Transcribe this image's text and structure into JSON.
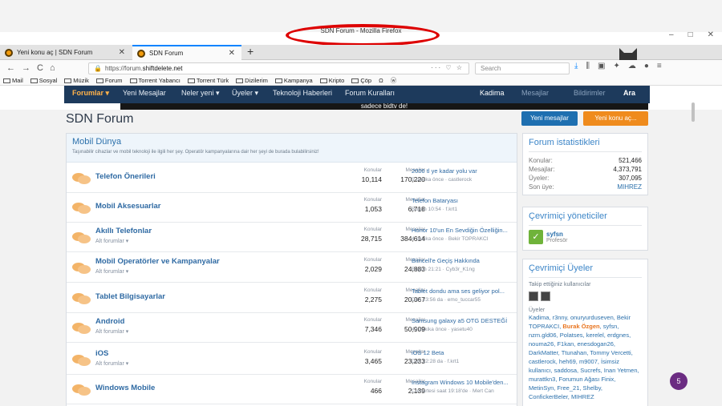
{
  "window": {
    "title": "SDN Forum - Mozilla Firefox",
    "controls": [
      "–",
      "□",
      "✕"
    ]
  },
  "tabs": [
    {
      "label": "Yeni konu aç | SDN Forum",
      "close": "✕"
    },
    {
      "label": "SDN Forum",
      "close": "✕"
    }
  ],
  "new_tab": "+",
  "nav": {
    "back": "←",
    "forward": "→",
    "reload": "C",
    "home": "⌂"
  },
  "url": {
    "prefix": "https://forum.",
    "host": "shiftdelete.net",
    "actions": "··· ♡ ☆"
  },
  "search": {
    "placeholder": "Search"
  },
  "toolbar_icons": [
    "⤓",
    "⫼",
    "▣",
    "✦",
    "☁",
    "●",
    "≡"
  ],
  "bookmarks": [
    "Mail",
    "Sosyal",
    "Müzik",
    "Forum",
    "Torrent Yabancı",
    "Torrent Türk",
    "Dizilerim",
    "Kampanya",
    "Kripto",
    "Çöp",
    "Ω",
    "ⓦ"
  ],
  "site_nav": {
    "items": [
      "Forumlar ▾",
      "Yeni Mesajlar",
      "Neler yeni ▾",
      "Üyeler ▾",
      "Teknoloji Haberleri",
      "Forum Kuralları"
    ],
    "right": [
      "Kadima",
      "Mesajlar",
      "Bildirimler",
      "Ara"
    ]
  },
  "strip_text": "sadece bidtv de!",
  "page": {
    "title": "SDN Forum",
    "new_messages_btn": "Yeni mesajlar",
    "new_topic_btn": "Yeni konu aç..."
  },
  "category": {
    "title": "Mobil Dünya",
    "desc": "Taşınabilir cihazlar ve mobil teknoloji ile ilgili her şey. Operatör kampanyalarına dair her şeyi de burada bulabilirsiniz!"
  },
  "forums": [
    {
      "name": "Telefon Önerileri",
      "sub": "",
      "konular": "10,114",
      "mesajlar": "170,220",
      "last_title": "2000 tl ye kadar yolu var",
      "last_meta": "5 dakika önce · castlerock"
    },
    {
      "name": "Mobil Aksesuarlar",
      "sub": "",
      "konular": "1,053",
      "mesajlar": "6,718",
      "last_title": "Telefon Bataryası",
      "last_meta": "Bugün 10:54 · f.krt1"
    },
    {
      "name": "Akıllı Telefonlar",
      "sub": "Alt forumlar ▾",
      "konular": "28,715",
      "mesajlar": "384,614",
      "last_title": "Honor 10'un En Sevdiğin Özelliğin...",
      "last_meta": "4 dakika önce · Bekir TOPRAKCI"
    },
    {
      "name": "Mobil Operatörler ve Kampanyalar",
      "sub": "Alt forumlar ▾",
      "konular": "2,029",
      "mesajlar": "24,883",
      "last_title": "Bimcell'e Geçiş Hakkında",
      "last_meta": "Bugün 21:21 · Cyb3r_K1ng"
    },
    {
      "name": "Tablet Bilgisayarlar",
      "sub": "",
      "konular": "2,275",
      "mesajlar": "20,067",
      "last_title": "Tablet dondu ama ses geliyor pol...",
      "last_meta": "Dün 23:56 da · emo_tuccar55"
    },
    {
      "name": "Android",
      "sub": "Alt forumlar ▾",
      "konular": "7,346",
      "mesajlar": "50,909",
      "last_title": "Samsung galaxy a5 OTG DESTEĞİ",
      "last_meta": "40 dakika önce · yasetu40"
    },
    {
      "name": "iOS",
      "sub": "Alt forumlar ▾",
      "konular": "3,465",
      "mesajlar": "23,233",
      "last_title": "iOS 12 Beta",
      "last_meta": "Dün 22:28 da · f.krt1"
    },
    {
      "name": "Windows Mobile",
      "sub": "",
      "konular": "466",
      "mesajlar": "2,139",
      "last_title": "Instagram Windows 10 Mobile'den...",
      "last_meta": "Cumartesi saat 19:18'de · Mert Can"
    }
  ],
  "labels": {
    "konular": "Konular",
    "mesajlar": "Mesajlar"
  },
  "stats_box": {
    "title": "Forum istatistikleri",
    "rows": [
      {
        "k": "Konular:",
        "v": "521,466"
      },
      {
        "k": "Mesajlar:",
        "v": "4,373,791"
      },
      {
        "k": "Üyeler:",
        "v": "307,095"
      },
      {
        "k": "Son üye:",
        "v": "MIHREZ"
      }
    ]
  },
  "staff_box": {
    "title": "Çevrimiçi yöneticiler",
    "name": "syfsn",
    "role": "Profesör"
  },
  "online_box": {
    "title": "Çevrimiçi Üyeler",
    "following": "Takip ettiğiniz kullanıcılar",
    "members_head": "Üyeler",
    "before": "Kadima, r3nny, onuryurduseven, Bekir TOPRAKCI, ",
    "highlight": "Burak Özgen",
    "after": ", syfsn, nzm.gld06, Polatses, kerelel, erdgnes, nouma26, F1kan, enesdogan26, DarkMatter, Ttunahan, Tommy Vercetti, castlerock, heh69, m9007, İsimsiz kullanıcı, saddosa, Sucrefs, Inan Yetmen, murattkn3, Forumun Ağası Finix, MetinSyn, Free_21, Shelby, ConfickerBeler, MIHREZ"
  },
  "notif_count": "5"
}
